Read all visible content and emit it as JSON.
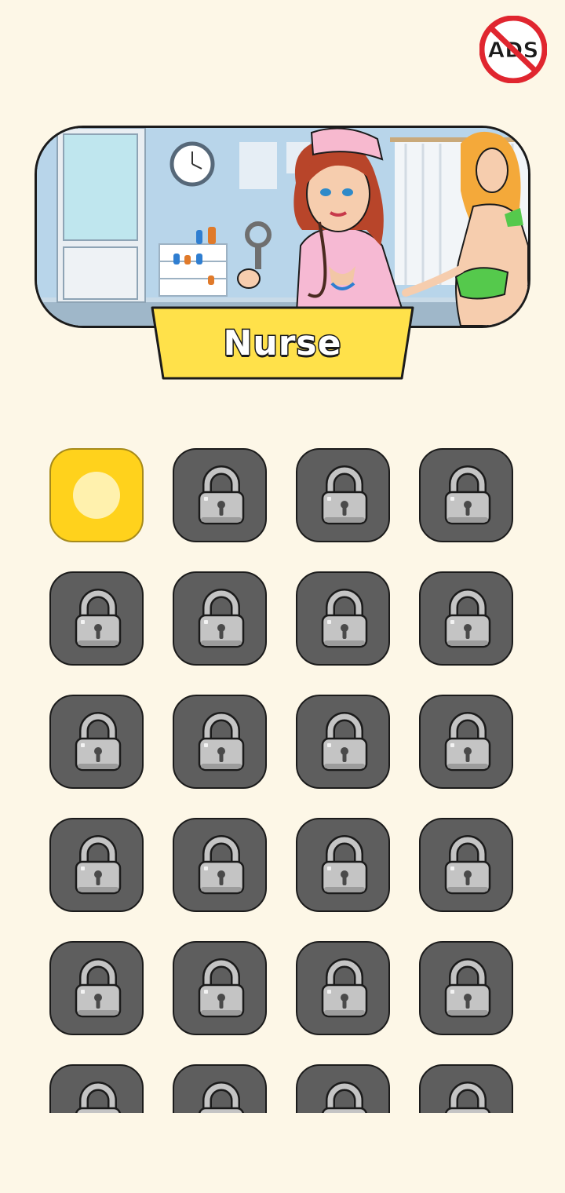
{
  "no_ads_button": {
    "label": "ADS",
    "icon": "no-ads-icon"
  },
  "banner": {
    "title": "Nurse",
    "colors": {
      "plate": "#ffe14a",
      "outline": "#1b1b1b"
    }
  },
  "levels": {
    "columns": 4,
    "visible_rows": 6,
    "tiles": [
      {
        "state": "unlocked"
      },
      {
        "state": "locked"
      },
      {
        "state": "locked"
      },
      {
        "state": "locked"
      },
      {
        "state": "locked"
      },
      {
        "state": "locked"
      },
      {
        "state": "locked"
      },
      {
        "state": "locked"
      },
      {
        "state": "locked"
      },
      {
        "state": "locked"
      },
      {
        "state": "locked"
      },
      {
        "state": "locked"
      },
      {
        "state": "locked"
      },
      {
        "state": "locked"
      },
      {
        "state": "locked"
      },
      {
        "state": "locked"
      },
      {
        "state": "locked"
      },
      {
        "state": "locked"
      },
      {
        "state": "locked"
      },
      {
        "state": "locked"
      },
      {
        "state": "locked"
      },
      {
        "state": "locked"
      },
      {
        "state": "locked"
      },
      {
        "state": "locked"
      }
    ],
    "colors": {
      "unlocked": "#ffd21c",
      "locked": "#5e5e5e",
      "lock_icon": "#c4c4c4"
    }
  }
}
